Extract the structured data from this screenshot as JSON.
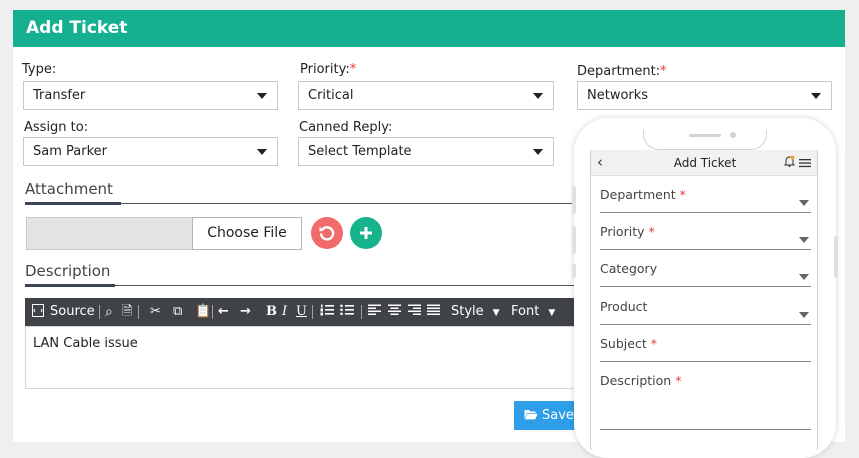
{
  "header": {
    "title": "Add Ticket"
  },
  "form": {
    "type": {
      "label": "Type:",
      "value": "Transfer"
    },
    "priority": {
      "label": "Priority:",
      "required": "*",
      "value": "Critical"
    },
    "department": {
      "label": "Department:",
      "required": "*",
      "value": "Networks"
    },
    "assign_to": {
      "label": "Assign to:",
      "value": "Sam Parker"
    },
    "canned_reply": {
      "label": "Canned Reply:",
      "value": "Select Template"
    }
  },
  "attachment": {
    "title": "Attachment",
    "choose_file_label": "Choose File",
    "reset_icon": "undo-icon",
    "add_icon": "plus-icon"
  },
  "description": {
    "title": "Description",
    "toolbar": {
      "source_label": "Source",
      "style_label": "Style",
      "font_label": "Font"
    },
    "content": "LAN Cable issue"
  },
  "save_button": {
    "label": "Save"
  },
  "mobile": {
    "title": "Add Ticket",
    "fields": [
      {
        "label": "Department",
        "required": "*"
      },
      {
        "label": "Priority",
        "required": "*"
      },
      {
        "label": "Category",
        "required": ""
      },
      {
        "label": "Product",
        "required": ""
      },
      {
        "label": "Subject",
        "required": "*"
      },
      {
        "label": "Description",
        "required": "*"
      }
    ]
  },
  "colors": {
    "header_bg": "#14b08f",
    "reset_button": "#f26b6b",
    "add_button": "#16b38c",
    "save_button": "#2e9ee8",
    "toolbar_bg": "#3f4246",
    "required": "#e03b3b"
  }
}
